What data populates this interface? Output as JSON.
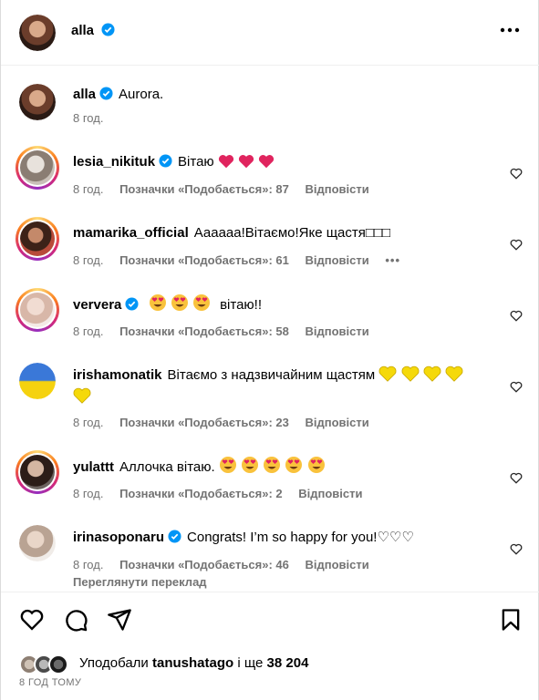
{
  "post": {
    "author": "alla",
    "caption": "Aurora.",
    "caption_time": "8 год."
  },
  "comments": [
    {
      "user": "lesia_nikituk",
      "verified": true,
      "text": "Вітаю",
      "emojis": "hearts-red-3",
      "time": "8 год.",
      "likes": "Позначки «Подобається»: 87",
      "reply": "Відповісти"
    },
    {
      "user": "mamarika_official",
      "verified": false,
      "text": "Аааааа!Вітаємо!Яке щастя□□□",
      "emojis": "",
      "time": "8 год.",
      "likes": "Позначки «Подобається»: 61",
      "reply": "Відповісти",
      "more": "•••"
    },
    {
      "user": "ververa",
      "verified": true,
      "text": "вітаю!!",
      "emojis": "heart-eyes-3",
      "time": "8 год.",
      "likes": "Позначки «Подобається»: 58",
      "reply": "Відповісти"
    },
    {
      "user": "irishamonatik",
      "verified": false,
      "text": "Вітаємо з надзвичайним щастям",
      "emojis": "hearts-yellow-5",
      "time": "8 год.",
      "likes": "Позначки «Подобається»: 23",
      "reply": "Відповісти"
    },
    {
      "user": "yulattt",
      "verified": false,
      "text": "Аллочка вітаю.",
      "emojis": "heart-eyes-5",
      "time": "8 год.",
      "likes": "Позначки «Подобається»: 2",
      "reply": "Відповісти"
    },
    {
      "user": "irinasoponaru",
      "verified": true,
      "text": "Congrats! I’m so happy for you!♡♡♡",
      "emojis": "",
      "time": "8 год.",
      "likes": "Позначки «Подобається»: 46",
      "reply": "Відповісти",
      "translate": "Переглянути переклад"
    }
  ],
  "footer": {
    "liked_prefix": "Уподобали",
    "liked_user": "tanushatago",
    "liked_mid": "і ще",
    "liked_count": "38 204",
    "time": "8 ГОД ТОМУ"
  },
  "colors": {
    "verified": "#0095f6",
    "meta": "#737373",
    "heart_red": "#e0245e",
    "heart_yellow": "#f5d90a"
  }
}
